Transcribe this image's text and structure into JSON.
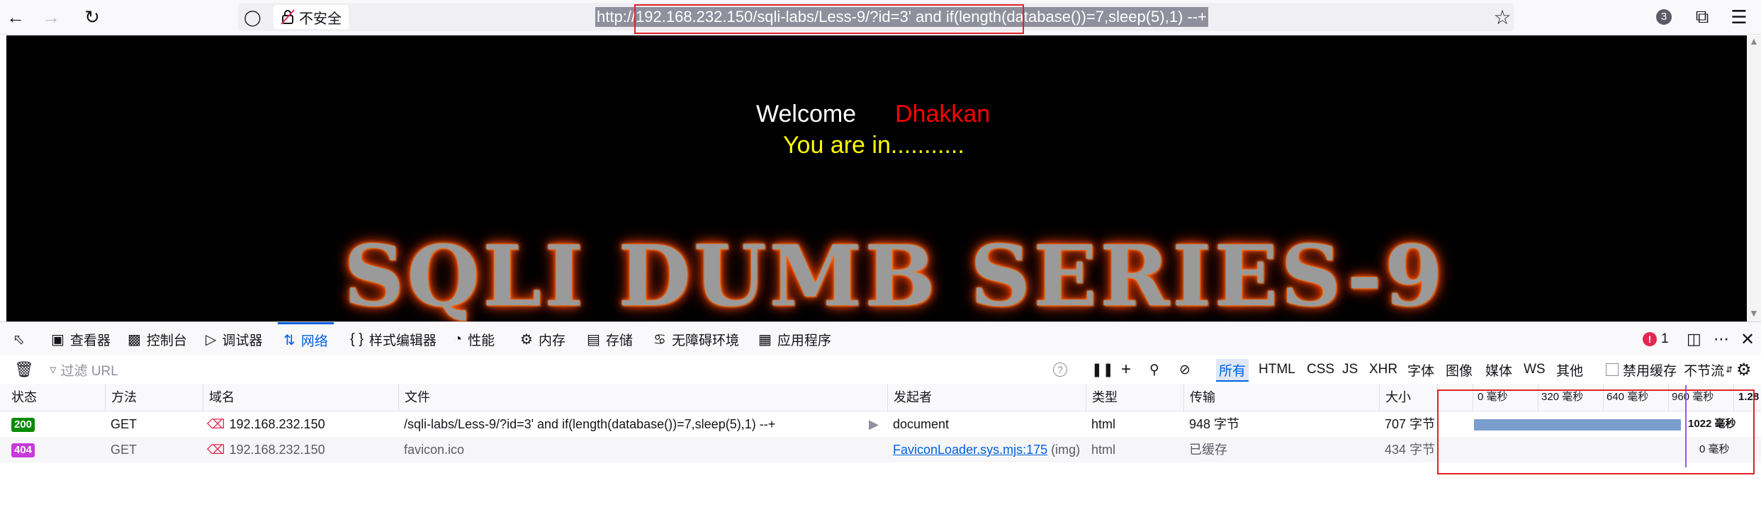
{
  "browser": {
    "back_icon": "arrow-left-icon",
    "forward_icon": "arrow-right-icon",
    "reload_icon": "reload-icon",
    "security_label": "不安全",
    "url": "http://192.168.232.150/sqli-labs/Less-9/?id=3' and if(length(database())=7,sleep(5),1) --+",
    "extensions_badge": "3"
  },
  "page": {
    "welcome": "Welcome",
    "name": "Dhakkan",
    "message": "You are in...........",
    "banner": "SQLI DUMB SERIES-9",
    "colors": {
      "name": "#ff0000",
      "message": "#ffff00",
      "background": "#000000"
    }
  },
  "devtools": {
    "tabs": [
      {
        "label": "查看器",
        "icon": "inspector-icon"
      },
      {
        "label": "控制台",
        "icon": "console-icon"
      },
      {
        "label": "调试器",
        "icon": "debugger-icon"
      },
      {
        "label": "网络",
        "icon": "network-icon"
      },
      {
        "label": "样式编辑器",
        "icon": "style-editor-icon"
      },
      {
        "label": "性能",
        "icon": "performance-icon"
      },
      {
        "label": "内存",
        "icon": "memory-icon"
      },
      {
        "label": "存储",
        "icon": "storage-icon"
      },
      {
        "label": "无障碍环境",
        "icon": "accessibility-icon"
      },
      {
        "label": "应用程序",
        "icon": "application-icon"
      }
    ],
    "active_tab": "网络",
    "error_count": "1",
    "filter_placeholder": "过滤 URL",
    "type_filters": [
      "所有",
      "HTML",
      "CSS",
      "JS",
      "XHR",
      "字体",
      "图像",
      "媒体",
      "WS",
      "其他"
    ],
    "disable_cache_label": "禁用缓存",
    "throttle_label": "不节流",
    "columns": [
      "状态",
      "方法",
      "域名",
      "文件",
      "发起者",
      "类型",
      "传输",
      "大小"
    ],
    "timeline_ticks": [
      "0 毫秒",
      "320 毫秒",
      "640 毫秒",
      "960 毫秒",
      "1.28"
    ],
    "requests": [
      {
        "status": "200",
        "method": "GET",
        "domain": "192.168.232.150",
        "file": "/sqli-labs/Less-9/?id=3' and if(length(database())=7,sleep(5),1) --+",
        "initiator": "document",
        "initiator_extra": "",
        "type": "html",
        "transferred": "948 字节",
        "size": "707 字节",
        "timing_label": "1022 毫秒",
        "timing_ms": 1022
      },
      {
        "status": "404",
        "method": "GET",
        "domain": "192.168.232.150",
        "file": "favicon.ico",
        "initiator": "FaviconLoader.sys.mjs:175",
        "initiator_extra": "(img)",
        "type": "html",
        "transferred": "已缓存",
        "size": "434 字节",
        "timing_label": "0 毫秒",
        "timing_ms": 0
      }
    ],
    "colors": {
      "accent": "#0061e0",
      "status_200": "#058b00",
      "status_404": "#c83adb",
      "timing_bar": "#7c9ecf",
      "error": "#e22850"
    }
  }
}
